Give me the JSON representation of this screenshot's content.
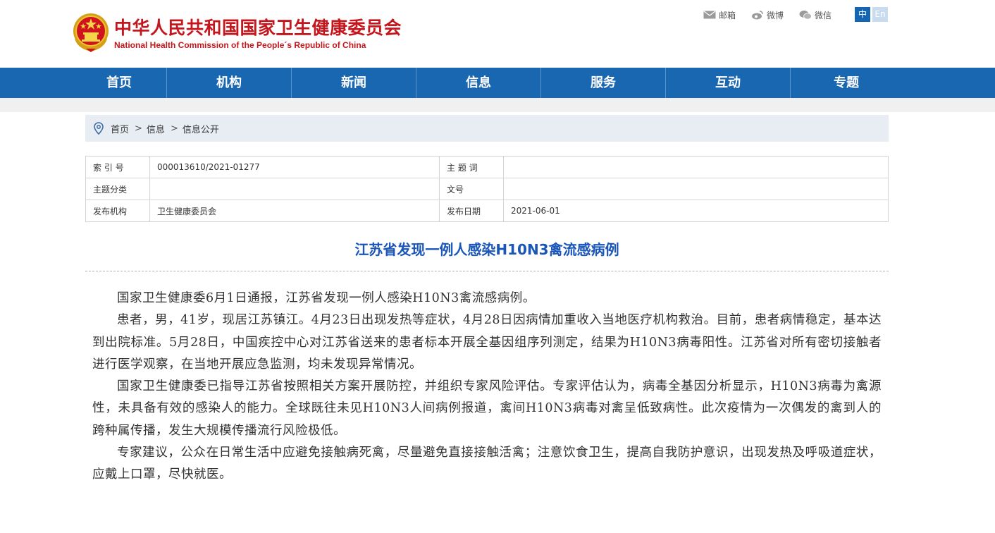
{
  "header": {
    "title_cn": "中华人民共和国国家卫生健康委员会",
    "title_en": "National Health Commission of the People´s Republic of China",
    "links": [
      {
        "label": "邮箱",
        "icon": "mail-icon"
      },
      {
        "label": "微博",
        "icon": "weibo-icon"
      },
      {
        "label": "微信",
        "icon": "wechat-icon"
      }
    ],
    "lang_zh": "中",
    "lang_en": "En"
  },
  "nav": {
    "items": [
      "首页",
      "机构",
      "新闻",
      "信息",
      "服务",
      "互动",
      "专题"
    ]
  },
  "breadcrumb": {
    "items": [
      "首页",
      "信息",
      "信息公开"
    ],
    "separator": ">"
  },
  "info": {
    "rows": [
      {
        "k1": "索 引 号",
        "v1": "000013610/2021-01277",
        "k2": "主 题 词",
        "v2": ""
      },
      {
        "k1": "主题分类",
        "v1": "",
        "k2": "文号",
        "v2": ""
      },
      {
        "k1": "发布机构",
        "v1": "卫生健康委员会",
        "k2": "发布日期",
        "v2": "2021-06-01"
      }
    ]
  },
  "article": {
    "title": "江苏省发现一例人感染H10N3禽流感病例",
    "paragraphs": [
      "国家卫生健康委6月1日通报，江苏省发现一例人感染H10N3禽流感病例。",
      "患者，男，41岁，现居江苏镇江。4月23日出现发热等症状，4月28日因病情加重收入当地医疗机构救治。目前，患者病情稳定，基本达到出院标准。5月28日，中国疾控中心对江苏省送来的患者标本开展全基因组序列测定，结果为H10N3病毒阳性。江苏省对所有密切接触者进行医学观察，在当地开展应急监测，均未发现异常情况。",
      "国家卫生健康委已指导江苏省按照相关方案开展防控，并组织专家风险评估。专家评估认为，病毒全基因分析显示，H10N3病毒为禽源性，未具备有效的感染人的能力。全球既往未见H10N3人间病例报道，禽间H10N3病毒对禽呈低致病性。此次疫情为一次偶发的禽到人的跨种属传播，发生大规模传播流行风险极低。",
      "专家建议，公众在日常生活中应避免接触病死禽，尽量避免直接接触活禽；注意饮食卫生，提高自我防护意识，出现发热及呼吸道症状，应戴上口罩，尽快就医。"
    ]
  },
  "colors": {
    "brand_red": "#c4161c",
    "nav_blue": "#1966b1",
    "title_blue": "#1a56b8"
  }
}
